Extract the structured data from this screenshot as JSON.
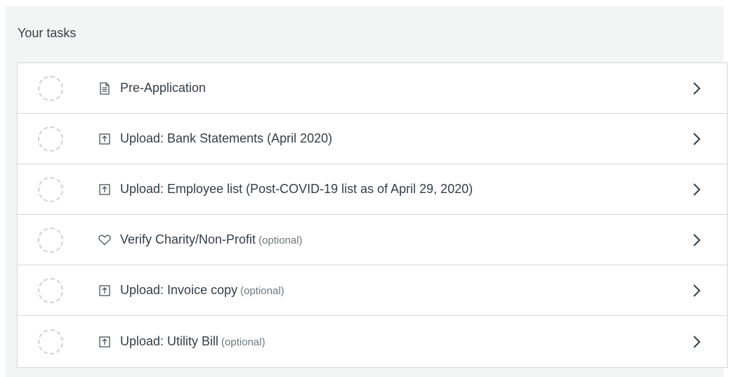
{
  "panel": {
    "title": "Your tasks"
  },
  "tasks": [
    {
      "label": "Pre-Application",
      "optional": "",
      "icon": "document-icon"
    },
    {
      "label": "Upload: Bank Statements (April 2020)",
      "optional": "",
      "icon": "upload-icon"
    },
    {
      "label": "Upload: Employee list (Post-COVID-19 list as of April 29, 2020)",
      "optional": "",
      "icon": "upload-icon"
    },
    {
      "label": "Verify Charity/Non-Profit",
      "optional": "(optional)",
      "icon": "heart-icon"
    },
    {
      "label": "Upload: Invoice copy",
      "optional": "(optional)",
      "icon": "upload-icon"
    },
    {
      "label": "Upload: Utility Bill",
      "optional": "(optional)",
      "icon": "upload-icon"
    }
  ],
  "colors": {
    "panel_bg": "#f3f4f4",
    "border": "#d3d6d8",
    "text": "#333e48",
    "muted": "#6b787f"
  }
}
